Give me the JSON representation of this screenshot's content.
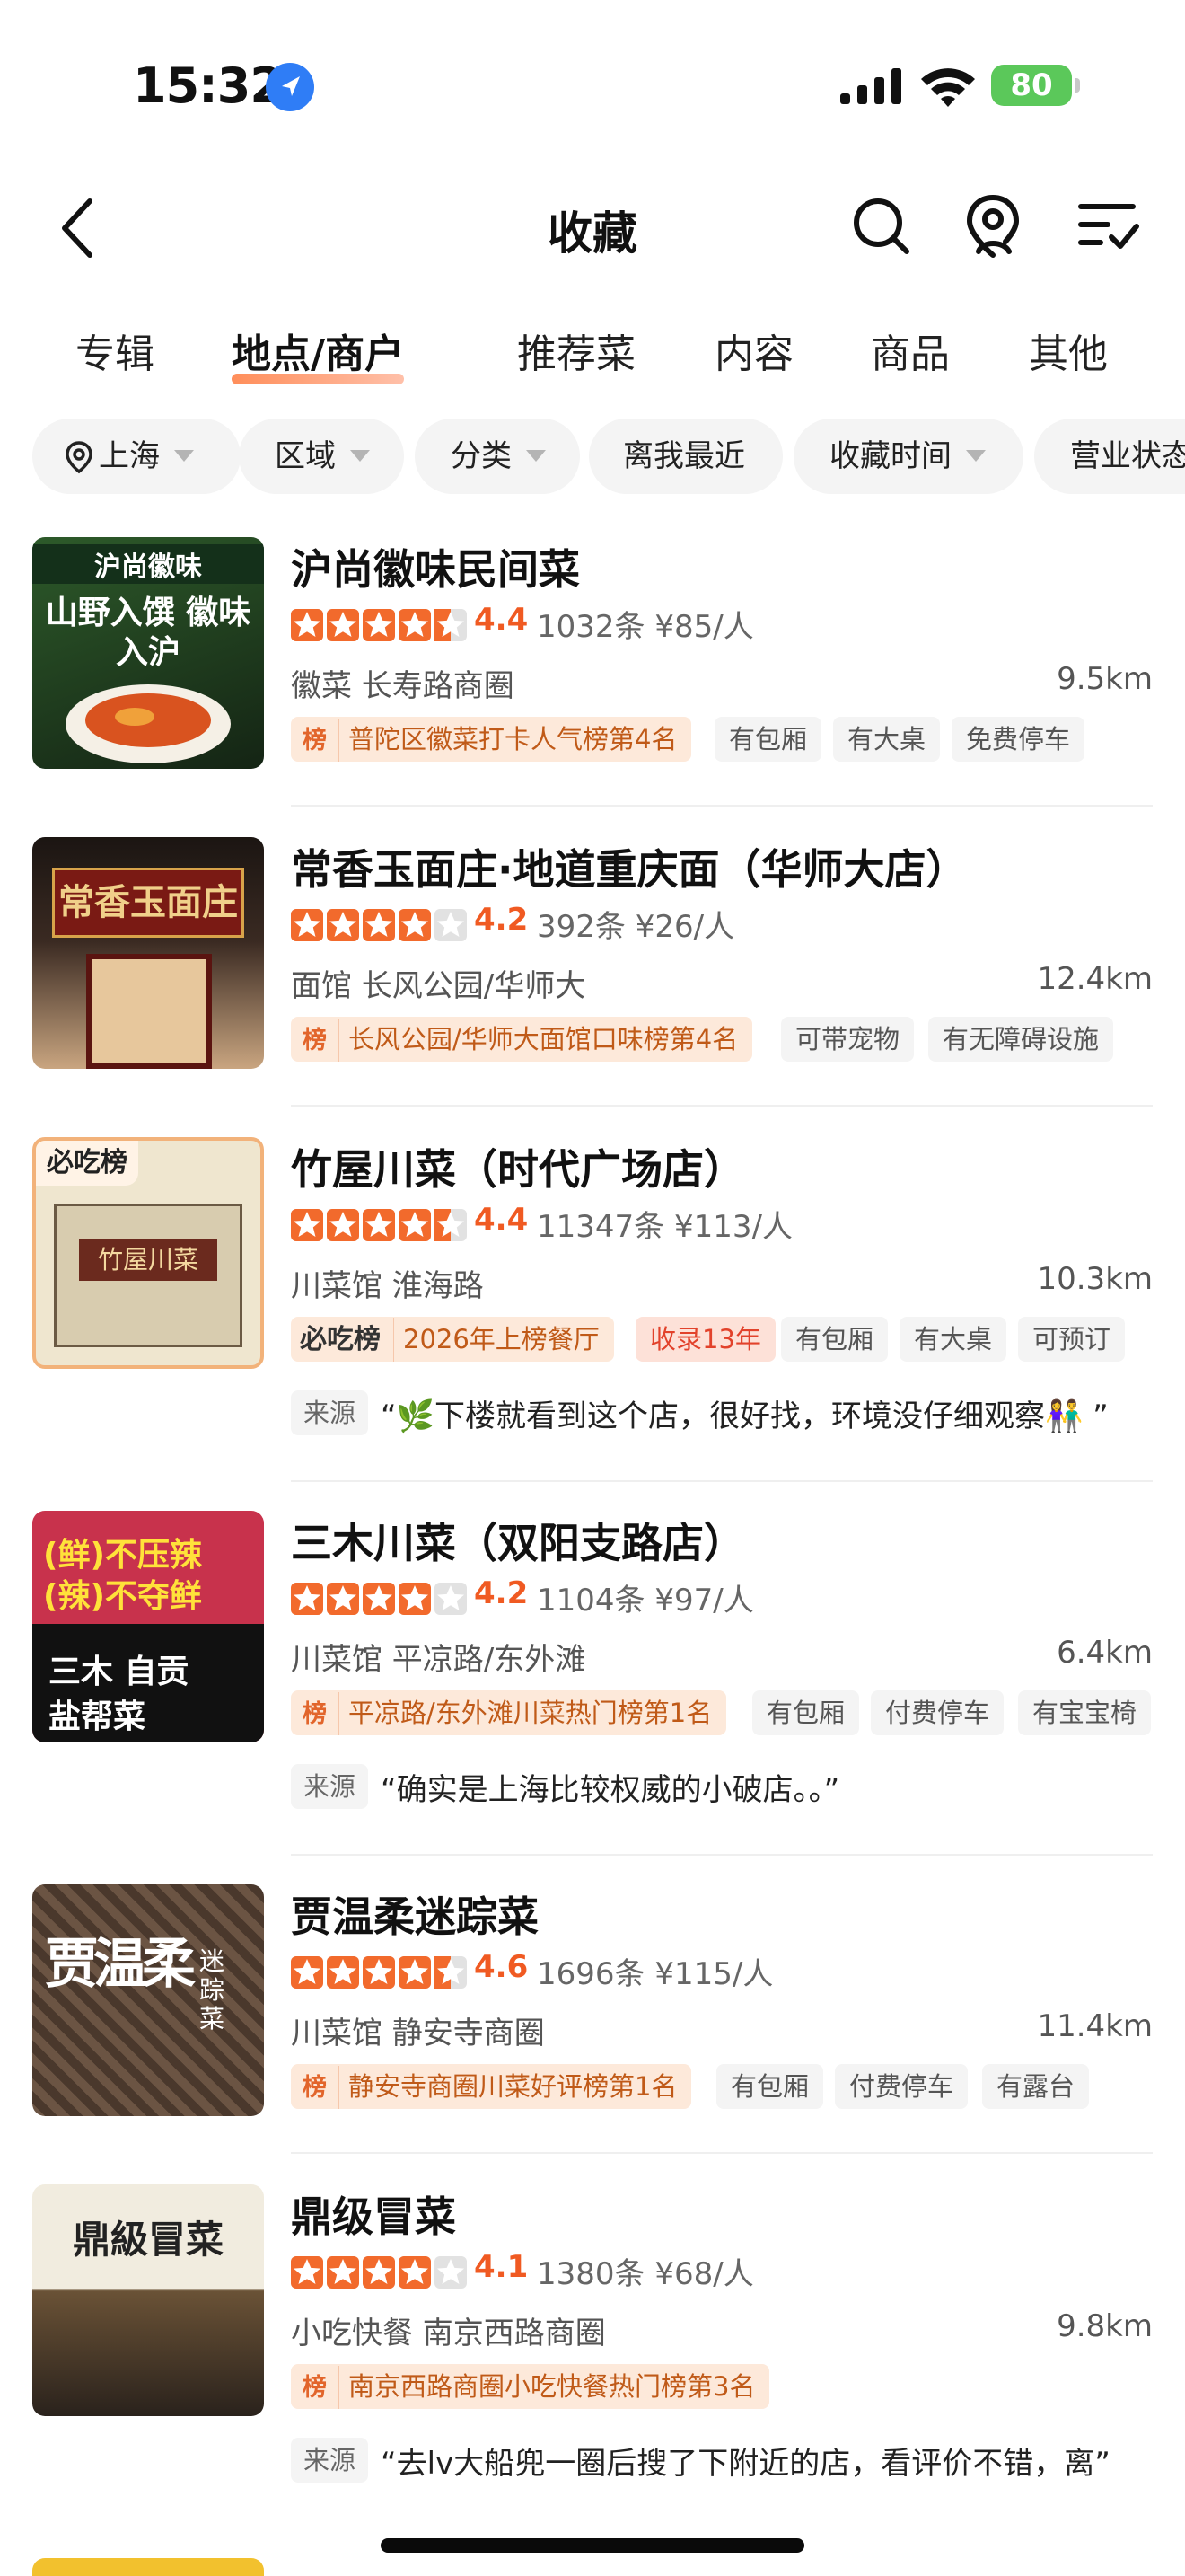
{
  "status": {
    "time": "15:32",
    "battery": "80"
  },
  "nav": {
    "title": "收藏",
    "icons": [
      "back-icon",
      "search-icon",
      "map-pin-user-icon",
      "list-check-icon"
    ]
  },
  "tabs": [
    "专辑",
    "地点/商户",
    "推荐菜",
    "内容",
    "商品",
    "其他"
  ],
  "active_tab": "地点/商户",
  "filters": [
    "上海",
    "区域",
    "分类",
    "离我最近",
    "收藏时间",
    "营业状态"
  ],
  "items": [
    {
      "name": "沪尚徽味民间菜",
      "rating": 4.4,
      "score": "4.4",
      "reviews": "1032条",
      "price": "¥85/人",
      "category": "徽菜 长寿路商圈",
      "distance": "9.5km",
      "rank": "普陀区徽菜打卡人气榜第4名",
      "tags": [
        "有包厢",
        "有大桌",
        "免费停车"
      ],
      "thumb": {
        "top": "沪尚徽味",
        "big": "山野入馔 徽味入沪",
        "bg": "#1f3a21"
      }
    },
    {
      "name": "常香玉面庄·地道重庆面（华师大店）",
      "rating": 4.2,
      "score": "4.2",
      "reviews": "392条",
      "price": "¥26/人",
      "category": "面馆 长风公园/华师大",
      "distance": "12.4km",
      "rank": "长风公园/华师大面馆口味榜第4名",
      "tags": [
        "可带宠物",
        "有无障碍设施"
      ],
      "thumb": {
        "big": "常香玉面庄",
        "bg": "#3a2a22"
      }
    },
    {
      "name": "竹屋川菜（时代广场店）",
      "rating": 4.4,
      "score": "4.4",
      "reviews": "11347条",
      "price": "¥113/人",
      "category": "川菜馆 淮海路",
      "distance": "10.3km",
      "chi": "必吃榜",
      "chi_text": "2026年上榜餐厅",
      "red": "收录13年",
      "tags": [
        "有包厢",
        "有大桌",
        "可预订"
      ],
      "source": "来源",
      "quote": "“🌿下楼就看到这个店，很好找，环境没仔细观察👫 ”",
      "thumb": {
        "badge": "必吃榜",
        "big": "竹屋川菜",
        "bg": "#e9dfc6"
      }
    },
    {
      "name": "三木川菜（双阳支路店）",
      "rating": 4.2,
      "score": "4.2",
      "reviews": "1104条",
      "price": "¥97/人",
      "category": "川菜馆 平凉路/东外滩",
      "distance": "6.4km",
      "rank": "平凉路/东外滩川菜热门榜第1名",
      "tags": [
        "有包厢",
        "付费停车",
        "有宝宝椅"
      ],
      "source": "来源",
      "quote": "“确实是上海比较权威的小破店。。”",
      "thumb": {
        "l1": "(鲜)不压辣",
        "l2": "(辣)不夺鲜",
        "l3": "三木 自贡",
        "l4": "盐帮菜",
        "bg": "#c8324c"
      }
    },
    {
      "name": "贾温柔迷踪菜",
      "rating": 4.6,
      "score": "4.6",
      "reviews": "1696条",
      "price": "¥115/人",
      "category": "川菜馆 静安寺商圈",
      "distance": "11.4km",
      "rank": "静安寺商圈川菜好评榜第1名",
      "tags": [
        "有包厢",
        "付费停车",
        "有露台"
      ],
      "thumb": {
        "big": "贾温柔",
        "small": "迷踪菜",
        "bg": "#5b4636"
      }
    },
    {
      "name": "鼎级冒菜",
      "rating": 4.1,
      "score": "4.1",
      "reviews": "1380条",
      "price": "¥68/人",
      "category": "小吃快餐 南京西路商圈",
      "distance": "9.8km",
      "rank": "南京西路商圈小吃快餐热门榜第3名",
      "tags": [],
      "source": "来源",
      "quote": "“去lv大船兜一圈后搜了下附近的店，看评价不错，离”",
      "thumb": {
        "big": "鼎級冒菜",
        "bg": "#2d2b28"
      }
    }
  ],
  "colors": {
    "accent": "#f05a22",
    "star": "#f26a2c",
    "rank_bg": "#fde9da",
    "chip_bg": "#f4f4f4"
  },
  "rank_badge": "榜"
}
